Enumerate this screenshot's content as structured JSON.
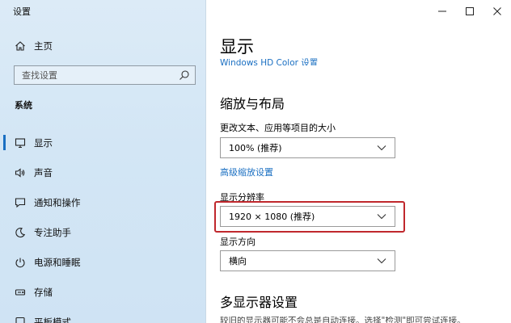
{
  "window": {
    "title": "设置"
  },
  "sidebar": {
    "home_label": "主页",
    "search_placeholder": "查找设置",
    "section_label": "系统",
    "items": [
      {
        "label": "显示",
        "icon": "monitor-icon",
        "active": true
      },
      {
        "label": "声音",
        "icon": "speaker-icon",
        "active": false
      },
      {
        "label": "通知和操作",
        "icon": "notification-icon",
        "active": false
      },
      {
        "label": "专注助手",
        "icon": "moon-icon",
        "active": false
      },
      {
        "label": "电源和睡眠",
        "icon": "power-icon",
        "active": false
      },
      {
        "label": "存储",
        "icon": "storage-icon",
        "active": false
      },
      {
        "label": "平板模式",
        "icon": "tablet-icon",
        "active": false
      }
    ]
  },
  "main": {
    "page_title": "显示",
    "partial_link": "Windows HD Color 设置",
    "scale_heading": "缩放与布局",
    "scale_label": "更改文本、应用等项目的大小",
    "scale_value": "100% (推荐)",
    "advanced_scaling_link": "高级缩放设置",
    "resolution_label": "显示分辨率",
    "resolution_value": "1920 × 1080 (推荐)",
    "orientation_label": "显示方向",
    "orientation_value": "横向",
    "multi_display_heading": "多显示器设置",
    "bottom_partial": "较旧的显示器可能不会总是自动连接。选择\"检测\"即可尝试连接。"
  },
  "colors": {
    "accent": "#1a6fc2",
    "highlight_border": "#c0282d",
    "sidebar_bg": "#d6e8f6"
  }
}
